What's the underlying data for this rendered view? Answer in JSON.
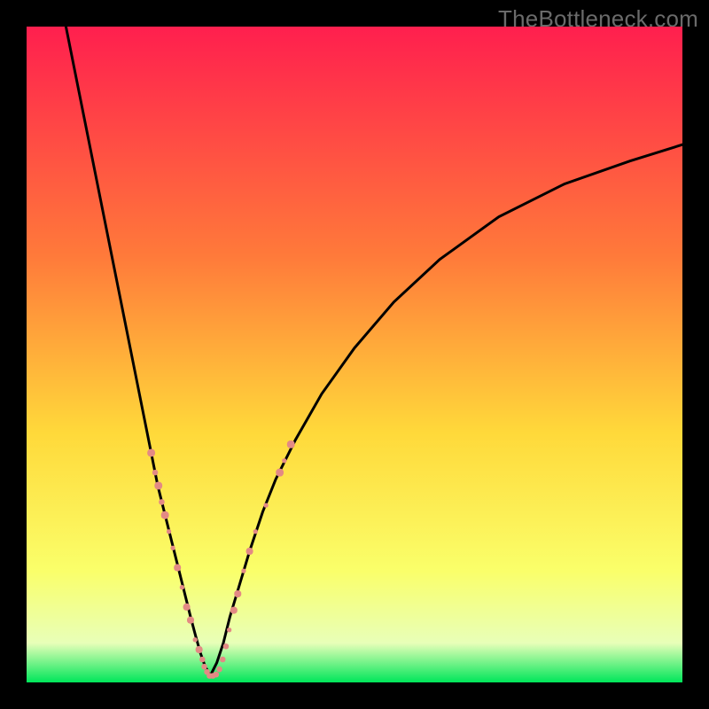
{
  "watermark": "TheBottleneck.com",
  "colors": {
    "frame": "#000000",
    "grad_top": "#ff1f4e",
    "grad_mid1": "#ff7a3a",
    "grad_mid2": "#ffd93a",
    "grad_mid3": "#faff6a",
    "grad_low": "#e8ffb8",
    "grad_bottom": "#00e65a",
    "curve": "#000000",
    "marker_fill": "#e38a84",
    "marker_stroke": "#d87771"
  },
  "chart_data": {
    "type": "line",
    "title": "",
    "xlabel": "",
    "ylabel": "",
    "xlim": [
      0,
      100
    ],
    "ylim": [
      0,
      100
    ],
    "series": [
      {
        "name": "bottleneck-curve-left",
        "x": [
          6,
          8,
          10,
          12,
          14,
          16,
          18,
          19,
          20,
          21,
          22,
          23,
          24,
          25,
          25.8,
          26.5,
          27.2,
          28
        ],
        "y": [
          100,
          90,
          80,
          70,
          60,
          50,
          40,
          35,
          30,
          26,
          22,
          18,
          14,
          10,
          7,
          4.5,
          2.5,
          1
        ]
      },
      {
        "name": "bottleneck-curve-right",
        "x": [
          28,
          29,
          30,
          31,
          32.5,
          34,
          36,
          38,
          41,
          45,
          50,
          56,
          63,
          72,
          82,
          92,
          100
        ],
        "y": [
          1,
          3,
          6,
          10,
          15,
          20,
          26,
          31,
          37,
          44,
          51,
          58,
          64.5,
          71,
          76,
          79.5,
          82
        ]
      }
    ],
    "markers": [
      {
        "x": 19.0,
        "y": 35.0,
        "r": 2.2
      },
      {
        "x": 19.6,
        "y": 32.0,
        "r": 1.6
      },
      {
        "x": 20.1,
        "y": 30.0,
        "r": 2.2
      },
      {
        "x": 20.6,
        "y": 27.5,
        "r": 1.6
      },
      {
        "x": 21.1,
        "y": 25.5,
        "r": 2.2
      },
      {
        "x": 21.7,
        "y": 23.0,
        "r": 1.3
      },
      {
        "x": 22.3,
        "y": 20.5,
        "r": 1.3
      },
      {
        "x": 23.0,
        "y": 17.5,
        "r": 2.0
      },
      {
        "x": 23.7,
        "y": 14.5,
        "r": 1.3
      },
      {
        "x": 24.4,
        "y": 11.5,
        "r": 2.0
      },
      {
        "x": 25.0,
        "y": 9.5,
        "r": 2.0
      },
      {
        "x": 25.7,
        "y": 6.5,
        "r": 1.3
      },
      {
        "x": 26.3,
        "y": 5.0,
        "r": 2.0
      },
      {
        "x": 26.8,
        "y": 3.5,
        "r": 1.6
      },
      {
        "x": 27.1,
        "y": 2.4,
        "r": 1.6
      },
      {
        "x": 27.5,
        "y": 1.6,
        "r": 1.6
      },
      {
        "x": 27.9,
        "y": 1.0,
        "r": 1.6
      },
      {
        "x": 28.4,
        "y": 1.0,
        "r": 1.6
      },
      {
        "x": 28.9,
        "y": 1.2,
        "r": 1.6
      },
      {
        "x": 29.4,
        "y": 2.0,
        "r": 1.6
      },
      {
        "x": 29.9,
        "y": 3.5,
        "r": 1.6
      },
      {
        "x": 30.4,
        "y": 5.5,
        "r": 1.6
      },
      {
        "x": 30.9,
        "y": 8.0,
        "r": 1.3
      },
      {
        "x": 31.6,
        "y": 11.0,
        "r": 2.0
      },
      {
        "x": 32.2,
        "y": 13.5,
        "r": 2.0
      },
      {
        "x": 33.1,
        "y": 17.0,
        "r": 1.3
      },
      {
        "x": 34.0,
        "y": 20.0,
        "r": 2.0
      },
      {
        "x": 34.9,
        "y": 23.0,
        "r": 1.3
      },
      {
        "x": 36.5,
        "y": 27.0,
        "r": 1.3
      },
      {
        "x": 38.6,
        "y": 32.0,
        "r": 2.2
      },
      {
        "x": 39.3,
        "y": 33.8,
        "r": 1.3
      },
      {
        "x": 40.3,
        "y": 36.3,
        "r": 2.2
      }
    ]
  }
}
